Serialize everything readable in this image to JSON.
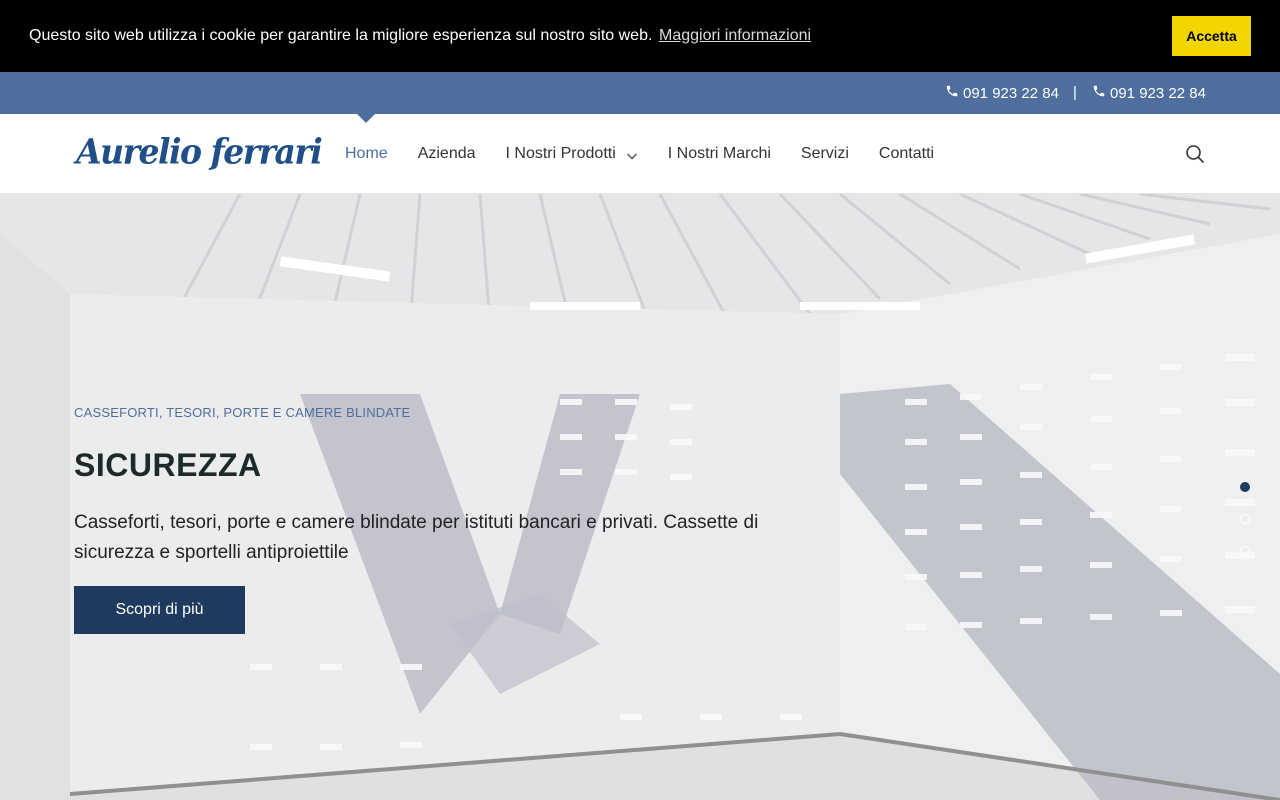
{
  "cookie": {
    "message": "Questo sito web utilizza i cookie per garantire la migliore esperienza sul nostro sito web.",
    "more_info": "Maggiori informazioni",
    "accept": "Accetta"
  },
  "topbar": {
    "phones": [
      "091 923 22 84",
      "091 923 22 84"
    ],
    "separator": "|"
  },
  "header": {
    "logo": "Aurelio ferrari",
    "nav": [
      {
        "label": "Home",
        "active": true
      },
      {
        "label": "Azienda"
      },
      {
        "label": "I Nostri Prodotti",
        "has_dropdown": true
      },
      {
        "label": "I Nostri Marchi"
      },
      {
        "label": "Servizi"
      },
      {
        "label": "Contatti"
      }
    ]
  },
  "hero": {
    "eyebrow": "CASSEFORTI, TESORI, PORTE E CAMERE BLINDATE",
    "title": "SICUREZZA",
    "description": "Casseforti, tesori, porte e camere blindate per istituti bancari e privati. Cassette di sicurezza e sportelli antiproiettile",
    "cta": "Scopri di più",
    "slide_count": 3,
    "active_slide": 1
  },
  "colors": {
    "accent": "#4e6e9e",
    "button": "#1f3a5f",
    "cookie_accept": "#f1d600"
  },
  "icons": [
    "phone-icon",
    "search-icon",
    "chevron-down-icon"
  ]
}
